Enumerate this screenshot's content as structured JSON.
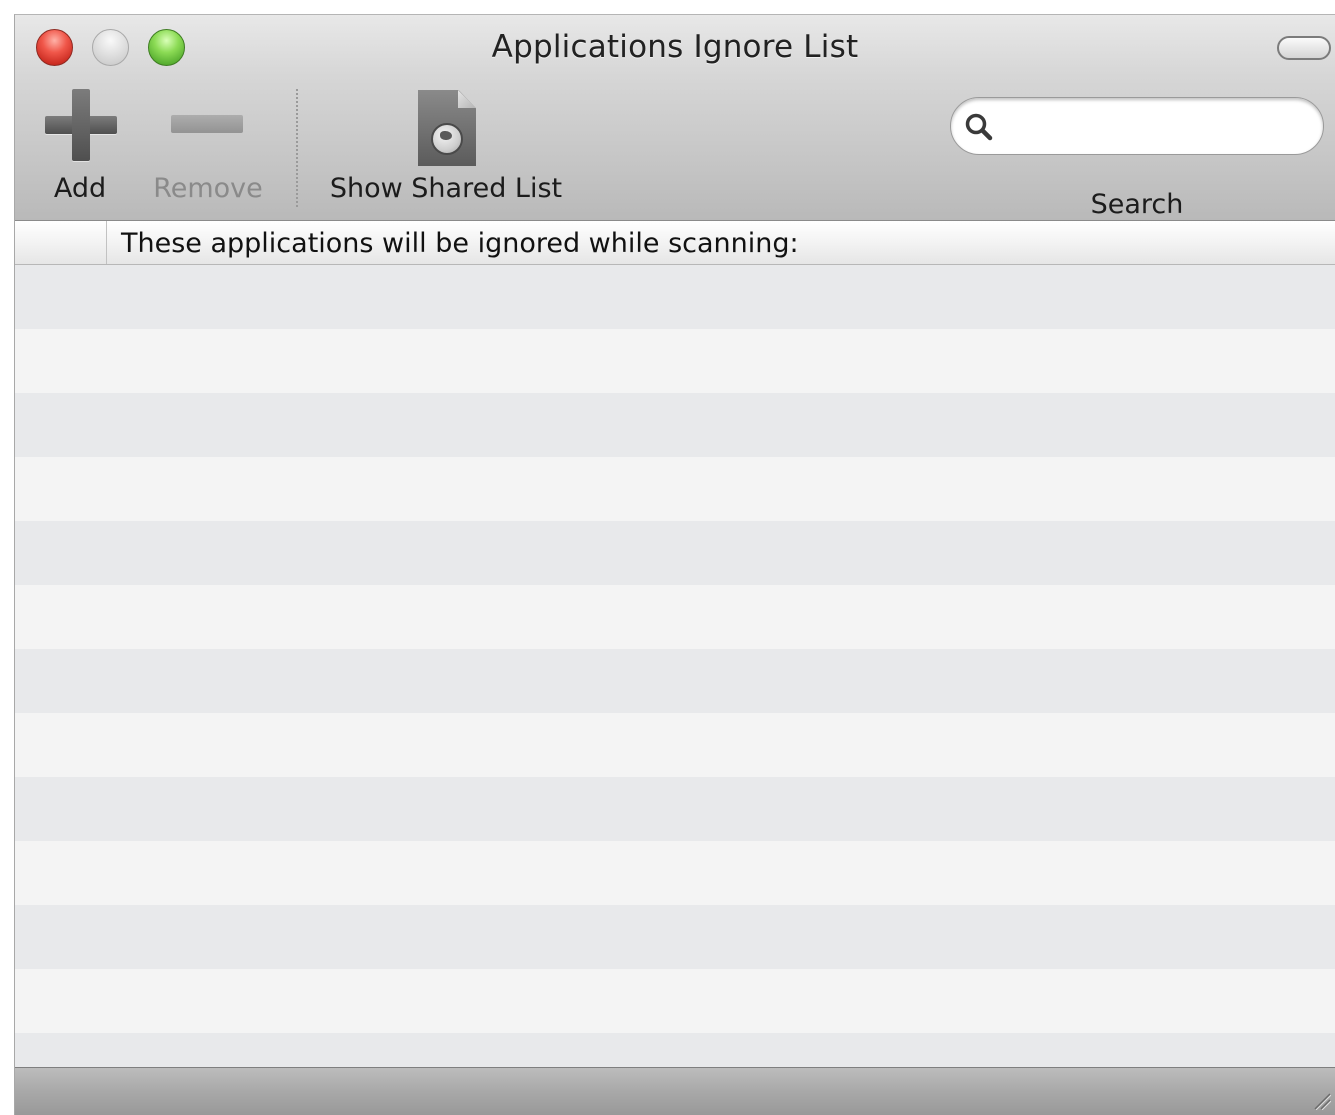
{
  "window": {
    "title": "Applications Ignore List"
  },
  "toolbar": {
    "add_label": "Add",
    "remove_label": "Remove",
    "show_shared_label": "Show Shared List",
    "search_label": "Search",
    "search_value": "",
    "search_placeholder": ""
  },
  "table": {
    "column_header": "These applications will be ignored while scanning:",
    "rows": []
  }
}
